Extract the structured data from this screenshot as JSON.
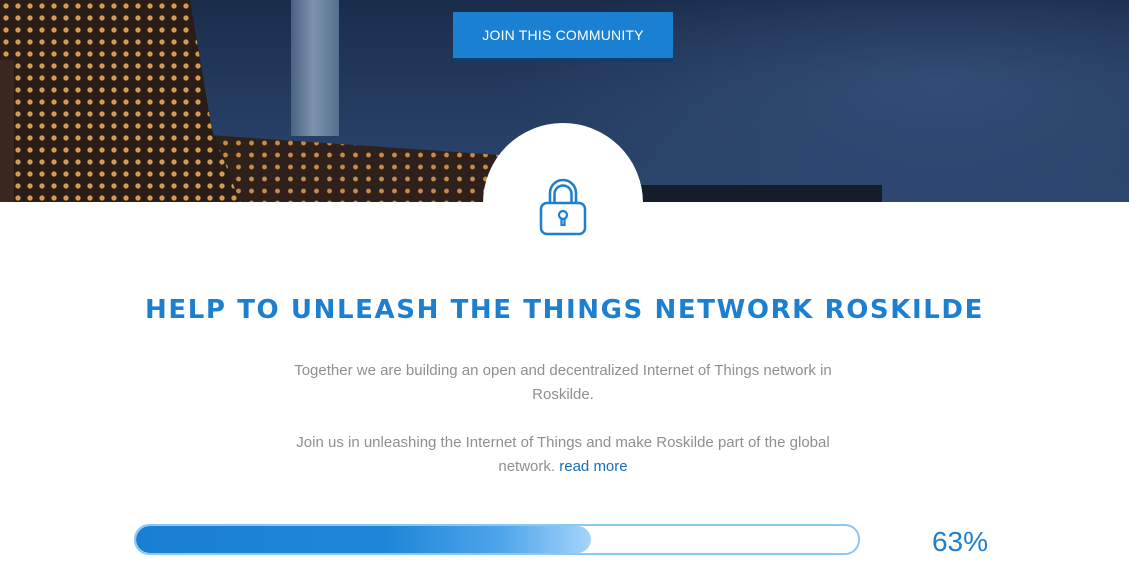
{
  "hero": {
    "join_button_label": "JOIN THIS COMMUNITY"
  },
  "icons": {
    "lock": "lock-icon"
  },
  "headline": "HELP TO UNLEASH THE THINGS NETWORK ROSKILDE",
  "paragraphs": {
    "p1": "Together we are building an open and decentralized Internet of Things network in Roskilde.",
    "p2_text": "Join us in unleashing the Internet of Things and make Roskilde part of the global network.",
    "read_more": "read more"
  },
  "progress": {
    "percent": 63,
    "label": "63%"
  },
  "colors": {
    "accent": "#1c7fcf",
    "button": "#1a80d2",
    "button_shadow": "#0e3f6b",
    "body_text": "#8f8f8f",
    "progress_border": "#8cc8f4"
  }
}
